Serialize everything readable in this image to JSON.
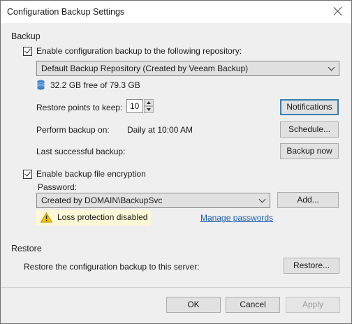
{
  "window": {
    "title": "Configuration Backup Settings"
  },
  "backup": {
    "section_label": "Backup",
    "enable_label": "Enable configuration backup to the following repository:",
    "enable_checked": true,
    "repository": "Default Backup Repository (Created by Veeam Backup)",
    "free_space": "32.2 GB free of 79.3 GB",
    "restore_points_label": "Restore points to keep:",
    "restore_points_value": "10",
    "perform_label": "Perform backup on:",
    "perform_value": "Daily at 10:00 AM",
    "last_label": "Last successful backup:",
    "last_value": "",
    "notifications_label": "Notifications",
    "schedule_label": "Schedule...",
    "backup_now_label": "Backup now",
    "encryption_label": "Enable backup file encryption",
    "encryption_checked": true,
    "password_label": "Password:",
    "password_value": "Created by DOMAIN\\BackupSvc",
    "add_label": "Add...",
    "warning_text": "Loss protection disabled",
    "manage_passwords_label": "Manage passwords"
  },
  "restore": {
    "section_label": "Restore",
    "description": "Restore the configuration backup to this server:",
    "restore_button_label": "Restore..."
  },
  "footer": {
    "ok_label": "OK",
    "cancel_label": "Cancel",
    "apply_label": "Apply"
  },
  "colors": {
    "accent": "#3c7fb1",
    "warning_bg": "#fff8d6",
    "warning_icon": "#f2c200",
    "link": "#1a5fb4"
  }
}
